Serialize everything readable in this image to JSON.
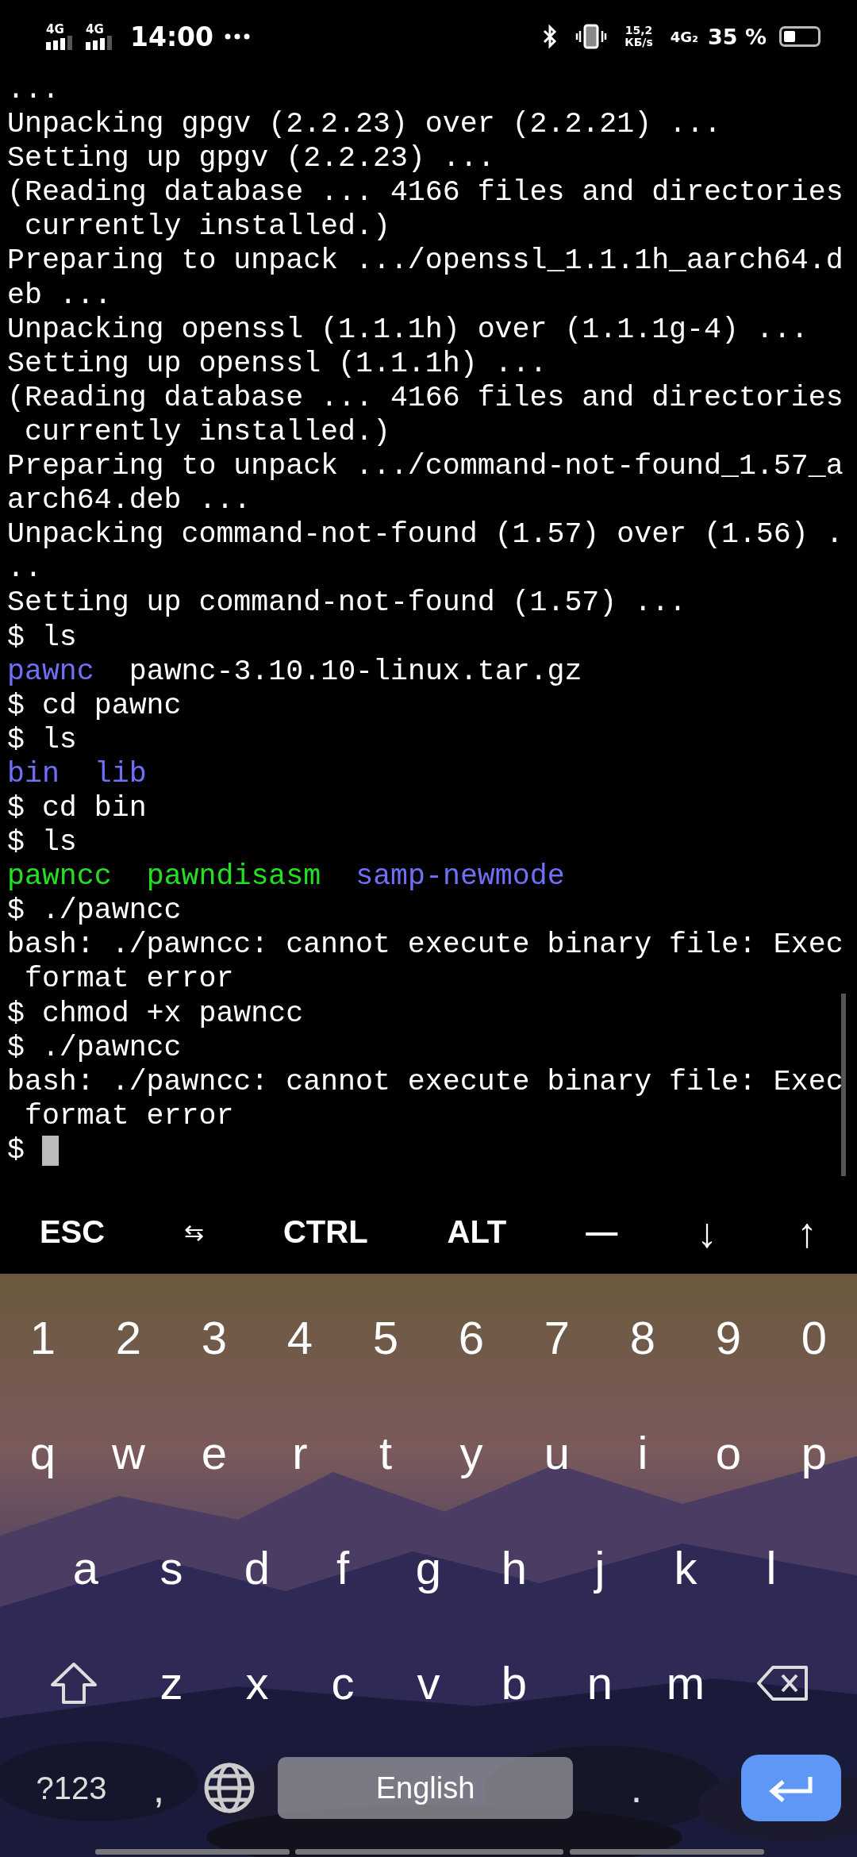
{
  "status_bar": {
    "signals": [
      {
        "label": "4G"
      },
      {
        "label": "4G"
      }
    ],
    "time": "14:00",
    "speed": {
      "value": "15,2",
      "unit": "КБ/s"
    },
    "network": "4G₂",
    "battery": "35 %"
  },
  "terminal": {
    "lines": [
      [
        {
          "text": "...",
          "color": "#ffffff"
        }
      ],
      [
        {
          "text": "Unpacking gpgv (2.2.23) over (2.2.21) ...",
          "color": "#ffffff"
        }
      ],
      [
        {
          "text": "Setting up gpgv (2.2.23) ...",
          "color": "#ffffff"
        }
      ],
      [
        {
          "text": "(Reading database ... 4166 files and directories",
          "color": "#ffffff"
        }
      ],
      [
        {
          "text": " currently installed.)",
          "color": "#ffffff"
        }
      ],
      [
        {
          "text": "Preparing to unpack .../openssl_1.1.1h_aarch64.d",
          "color": "#ffffff"
        }
      ],
      [
        {
          "text": "eb ...",
          "color": "#ffffff"
        }
      ],
      [
        {
          "text": "Unpacking openssl (1.1.1h) over (1.1.1g-4) ...",
          "color": "#ffffff"
        }
      ],
      [
        {
          "text": "Setting up openssl (1.1.1h) ...",
          "color": "#ffffff"
        }
      ],
      [
        {
          "text": "(Reading database ... 4166 files and directories",
          "color": "#ffffff"
        }
      ],
      [
        {
          "text": " currently installed.)",
          "color": "#ffffff"
        }
      ],
      [
        {
          "text": "Preparing to unpack .../command-not-found_1.57_a",
          "color": "#ffffff"
        }
      ],
      [
        {
          "text": "arch64.deb ...",
          "color": "#ffffff"
        }
      ],
      [
        {
          "text": "Unpacking command-not-found (1.57) over (1.56) .",
          "color": "#ffffff"
        }
      ],
      [
        {
          "text": "..",
          "color": "#ffffff"
        }
      ],
      [
        {
          "text": "Setting up command-not-found (1.57) ...",
          "color": "#ffffff"
        }
      ],
      [
        {
          "text": "$ ls",
          "color": "#ffffff"
        }
      ],
      [
        {
          "text": "pawnc",
          "color": "#6f6ff7"
        },
        {
          "text": "pawnc-3.10.10-linux.tar.gz",
          "color": "#ffffff"
        }
      ],
      [
        {
          "text": "$ cd pawnc",
          "color": "#ffffff"
        }
      ],
      [
        {
          "text": "$ ls",
          "color": "#ffffff"
        }
      ],
      [
        {
          "text": "bin",
          "color": "#6f6ff7"
        },
        {
          "text": "lib",
          "color": "#6f6ff7"
        }
      ],
      [
        {
          "text": "$ cd bin",
          "color": "#ffffff"
        }
      ],
      [
        {
          "text": "$ ls",
          "color": "#ffffff"
        }
      ],
      [
        {
          "text": "pawncc",
          "color": "#22e022"
        },
        {
          "text": "pawndisasm",
          "color": "#22e022"
        },
        {
          "text": "samp-newmode",
          "color": "#6f6ff7"
        }
      ],
      [
        {
          "text": "$ ./pawncc",
          "color": "#ffffff"
        }
      ],
      [
        {
          "text": "bash: ./pawncc: cannot execute binary file: Exec",
          "color": "#ffffff"
        }
      ],
      [
        {
          "text": " format error",
          "color": "#ffffff"
        }
      ],
      [
        {
          "text": "$ chmod +x pawncc",
          "color": "#ffffff"
        }
      ],
      [
        {
          "text": "$ ./pawncc",
          "color": "#ffffff"
        }
      ],
      [
        {
          "text": "bash: ./pawncc: cannot execute binary file: Exec",
          "color": "#ffffff"
        }
      ],
      [
        {
          "text": " format error",
          "color": "#ffffff"
        }
      ]
    ],
    "prompt": "$"
  },
  "extra_keys": [
    "ESC",
    "⇆",
    "CTRL",
    "ALT",
    "—",
    "↓",
    "↑"
  ],
  "keyboard": {
    "rows": [
      [
        "1",
        "2",
        "3",
        "4",
        "5",
        "6",
        "7",
        "8",
        "9",
        "0"
      ],
      [
        "q",
        "w",
        "e",
        "r",
        "t",
        "y",
        "u",
        "i",
        "o",
        "p"
      ],
      [
        "a",
        "s",
        "d",
        "f",
        "g",
        "h",
        "j",
        "k",
        "l"
      ],
      [
        "z",
        "x",
        "c",
        "v",
        "b",
        "n",
        "m"
      ]
    ],
    "symbols_key": "?123",
    "comma": ",",
    "space": "English",
    "period": "."
  }
}
